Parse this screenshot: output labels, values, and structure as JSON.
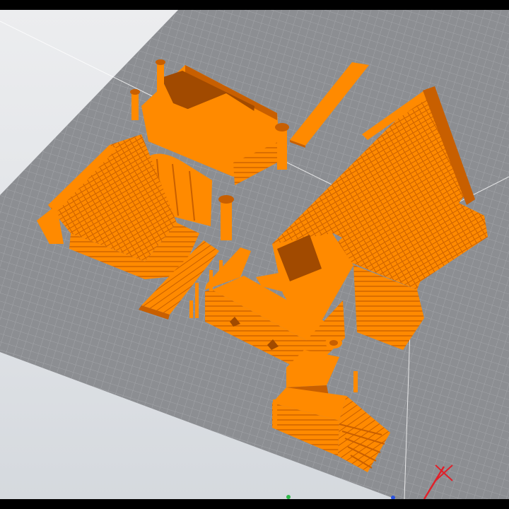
{
  "colors": {
    "window_frame": "#000000",
    "viewport_background": "#e4e6e9",
    "build_plate": "#8c8e92",
    "grid_line": "#a2a4a8",
    "model": "#ff8a00",
    "model_shadow": "#c85f00",
    "model_dark": "#a14a00",
    "bounding_box": "#ffffff",
    "axis_x": "#e0202a",
    "axis_y": "#2fb84a",
    "axis_z": "#2a52e0"
  },
  "scene": {
    "view": "3d-perspective",
    "build_plate": "gray-grid",
    "models": [
      "house-walls-with-columns",
      "house-roof-left",
      "wooden-plank-strip",
      "house-roof-right-large",
      "courtyard-fence-walls",
      "wooden-ramp",
      "stair-tower"
    ],
    "axis_gizmo_icons": [
      "x-axis-icon",
      "y-axis-icon",
      "z-axis-icon"
    ]
  }
}
